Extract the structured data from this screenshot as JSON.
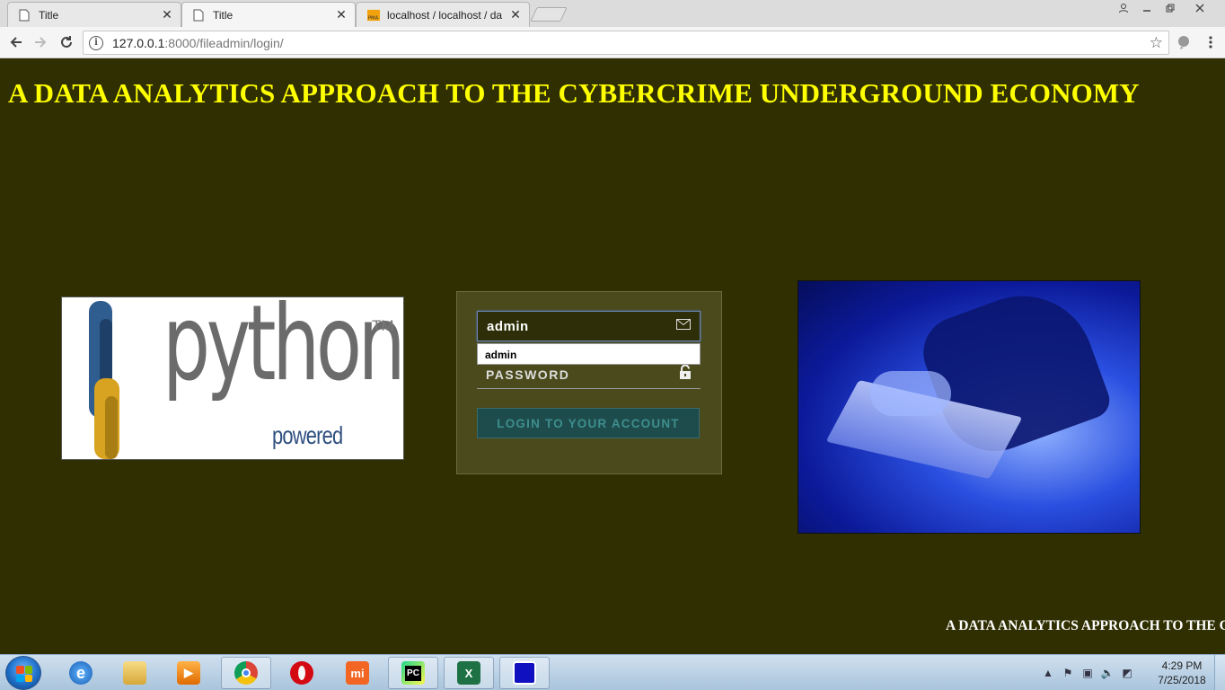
{
  "browser": {
    "tabs": [
      {
        "label": "Title",
        "favicon": "page-icon",
        "active": false
      },
      {
        "label": "Title",
        "favicon": "page-icon",
        "active": true
      },
      {
        "label": "localhost / localhost / da",
        "favicon": "phpmyadmin-icon",
        "active": false
      }
    ],
    "url_host": "127.0.0.1",
    "url_rest": ":8000/fileadmin/login/"
  },
  "page": {
    "title": "A DATA ANALYTICS APPROACH TO THE CYBERCRIME UNDERGROUND ECONOMY",
    "marquee": "A DATA ANALYTICS APPROACH TO THE C",
    "python_logo": {
      "word": "python",
      "tm": "TM",
      "powered": "powered"
    }
  },
  "login": {
    "username_value": "admin",
    "autocomplete_suggestion": "admin",
    "password_placeholder": "PASSWORD",
    "submit_label": "LOGIN TO YOUR ACCOUNT"
  },
  "taskbar": {
    "apps": [
      "internet-explorer-icon",
      "file-explorer-icon",
      "media-player-icon",
      "chrome-icon",
      "opera-icon",
      "mi-icon",
      "pycharm-icon",
      "excel-icon",
      "remote-desktop-icon"
    ],
    "time": "4:29 PM",
    "date": "7/25/2018"
  },
  "colors": {
    "page_bg": "#2f2f02",
    "title": "#ffff00",
    "login_box": "#4a4a1d",
    "login_button": "#1e4c4c"
  }
}
